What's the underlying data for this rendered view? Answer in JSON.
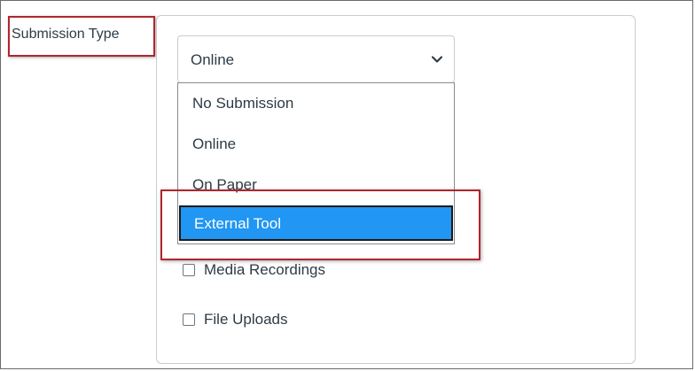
{
  "form": {
    "submission_type_label": "Submission Type",
    "select": {
      "selected_value": "Online",
      "options": [
        "No Submission",
        "Online",
        "On Paper",
        "External Tool"
      ],
      "highlighted_option": "External Tool"
    },
    "checkboxes": [
      {
        "label": "Media Recordings",
        "checked": false
      },
      {
        "label": "File Uploads",
        "checked": false
      }
    ]
  },
  "colors": {
    "highlight_border": "#b0262d",
    "selected_option_bg": "#2196f3",
    "text": "#2d3b45"
  },
  "icons": {
    "select_caret": "chevron-down-icon"
  }
}
